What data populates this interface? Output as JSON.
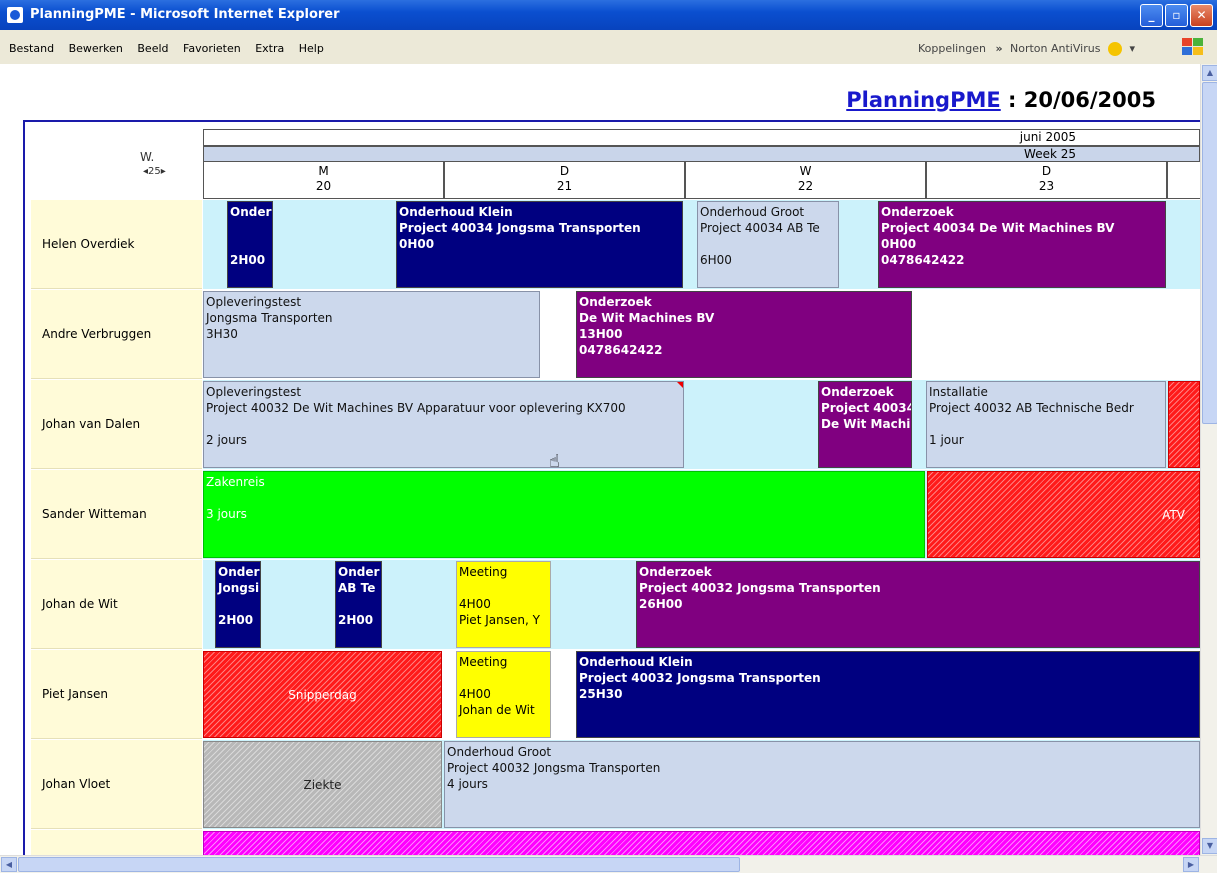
{
  "window": {
    "title": "PlanningPME - Microsoft Internet Explorer"
  },
  "menu": {
    "items": [
      "Bestand",
      "Bewerken",
      "Beeld",
      "Favorieten",
      "Extra",
      "Help"
    ],
    "links": "Koppelingen",
    "links_chevron": "»",
    "norton": "Norton AntiVirus",
    "norton_arrow": "▾"
  },
  "page": {
    "app_name": "PlanningPME",
    "separator": " : ",
    "date": "20/06/2005"
  },
  "calendar": {
    "week_label": "W.",
    "week_nav": "◂25▸",
    "month": "juni 2005",
    "week": "Week 25",
    "days": [
      {
        "letter": "M",
        "num": "20"
      },
      {
        "letter": "D",
        "num": "21"
      },
      {
        "letter": "W",
        "num": "22"
      },
      {
        "letter": "D",
        "num": "23"
      }
    ]
  },
  "employees": [
    {
      "name": "Helen Overdiek"
    },
    {
      "name": "Andre Verbruggen"
    },
    {
      "name": "Johan van Dalen"
    },
    {
      "name": "Sander Witteman"
    },
    {
      "name": "Johan de Wit"
    },
    {
      "name": "Piet Jansen"
    },
    {
      "name": "Johan Vloet"
    }
  ],
  "events": {
    "e1": {
      "l1": "Onder",
      "l4": "2H00"
    },
    "e2": {
      "l1": "Onderhoud Klein",
      "l2": "Project 40034 Jongsma Transporten",
      "l3": "0H00"
    },
    "e3": {
      "l1": "Onderhoud Groot",
      "l2": "Project 40034 AB Te",
      "l4": "6H00"
    },
    "e4": {
      "l1": "Onderzoek",
      "l2": "Project 40034 De Wit Machines BV",
      "l3": "0H00",
      "l4": "0478642422"
    },
    "e5": {
      "l1": "Opleveringstest",
      "l2": "Jongsma Transporten",
      "l3": "3H30"
    },
    "e6": {
      "l1": "Onderzoek",
      "l2": "De Wit Machines BV",
      "l3": "13H00",
      "l4": "0478642422"
    },
    "e7": {
      "l1": "Opleveringstest",
      "l2": "Project 40032 De Wit Machines BV  Apparatuur voor oplevering KX700",
      "l4": "2 jours"
    },
    "e8": {
      "l1": "Onderzoek",
      "l2": "Project 40034",
      "l3": "De Wit Machi"
    },
    "e9": {
      "l1": "Installatie",
      "l2": "Project 40032 AB Technische Bedr",
      "l4": "1 jour"
    },
    "e10": {
      "l1": "Zakenreis",
      "l3": "3 jours"
    },
    "e11": {
      "label": "ATV"
    },
    "e12": {
      "l1": "Onder",
      "l2": "Jongsi",
      "l4": "2H00"
    },
    "e13": {
      "l1": "Onder",
      "l2": "AB Te",
      "l4": "2H00"
    },
    "e14": {
      "l1": "Meeting",
      "l3": "4H00",
      "l4": "Piet Jansen, Y"
    },
    "e15": {
      "l1": "Onderzoek",
      "l2": "Project 40032 Jongsma Transporten",
      "l3": "26H00"
    },
    "e16": {
      "label": "Snipperdag"
    },
    "e17": {
      "l1": "Meeting",
      "l3": "4H00",
      "l4": "Johan de Wit"
    },
    "e18": {
      "l1": "Onderhoud Klein",
      "l2": "Project 40032 Jongsma Transporten",
      "l3": "25H30"
    },
    "e19": {
      "label": "Ziekte"
    },
    "e20": {
      "l1": "Onderhoud Groot",
      "l2": "Project 40032 Jongsma Transporten",
      "l3": "4 jours"
    }
  },
  "colors": {
    "navy": "#000080",
    "purple": "#800080",
    "light_blue": "#ccd8ec",
    "green": "#00ff00",
    "yellow": "#ffff00",
    "red": "#ff1a1a",
    "gray": "#b8b8b8",
    "magenta": "#ff00ff",
    "employee_bg": "#fffbd8",
    "row_bg": "#ccf2fb"
  }
}
